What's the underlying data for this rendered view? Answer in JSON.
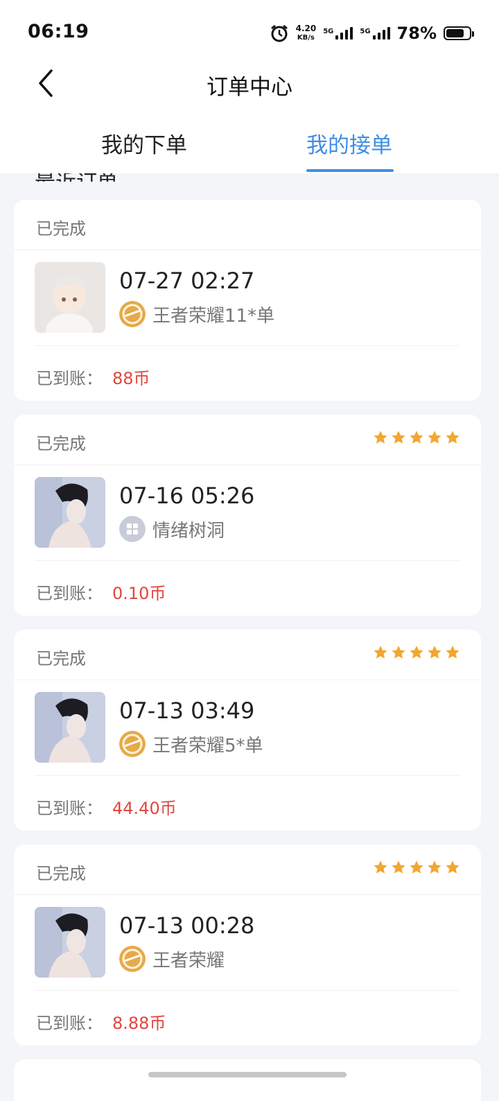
{
  "status_bar": {
    "time": "06:19",
    "speed_value": "4.20",
    "speed_unit": "KB/s",
    "network1": "5G",
    "network2": "5G",
    "battery": "78%",
    "battery_level": 0.78
  },
  "header": {
    "title": "订单中心",
    "tabs": [
      {
        "label": "我的下单",
        "active": false
      },
      {
        "label": "我的接单",
        "active": true
      }
    ],
    "partial_text": "最近订单"
  },
  "colors": {
    "accent": "#3f8ee6",
    "amount": "#e0473e",
    "star": "#f2a72e"
  },
  "orders": [
    {
      "status": "已完成",
      "rating": 0,
      "datetime": "07-27 02:27",
      "game_icon": "honor-of-kings-icon",
      "game": "王者荣耀11*单",
      "paid_label": "已到账：",
      "amount": "88币",
      "avatar": "anime-avatar"
    },
    {
      "status": "已完成",
      "rating": 5,
      "datetime": "07-16 05:26",
      "game_icon": "grid-icon",
      "game": "情绪树洞",
      "paid_label": "已到账：",
      "amount": "0.10币",
      "avatar": "woman-avatar"
    },
    {
      "status": "已完成",
      "rating": 5,
      "datetime": "07-13 03:49",
      "game_icon": "honor-of-kings-icon",
      "game": "王者荣耀5*单",
      "paid_label": "已到账：",
      "amount": "44.40币",
      "avatar": "woman-avatar"
    },
    {
      "status": "已完成",
      "rating": 5,
      "datetime": "07-13 00:28",
      "game_icon": "honor-of-kings-icon",
      "game": "王者荣耀",
      "paid_label": "已到账：",
      "amount": "8.88币",
      "avatar": "woman-avatar"
    }
  ]
}
